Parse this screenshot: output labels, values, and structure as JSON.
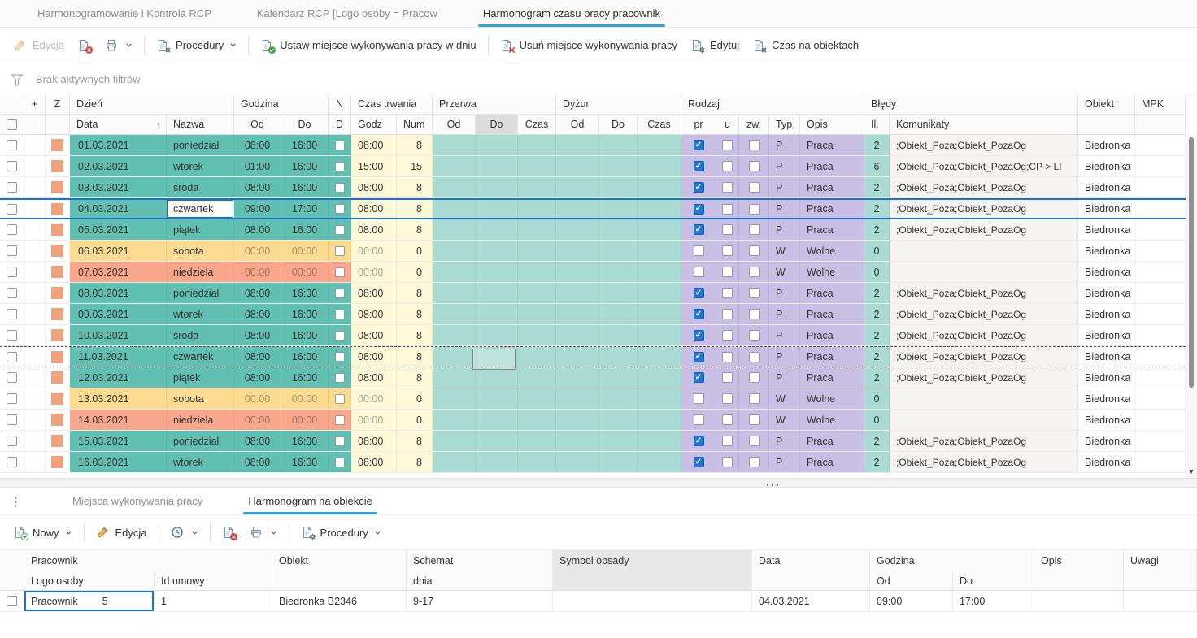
{
  "colors": {
    "accent": "#1a73c2",
    "teal": "#62c0b2",
    "teal_light": "#a9dbd2",
    "yellow_light": "#fdf8d7",
    "purple": "#c9bfe5",
    "saturday": "#fbdb90",
    "sunday": "#f9a78c",
    "z_badge": "#f1a17c",
    "check_blue": "#2176d2"
  },
  "icons": {
    "sort_asc": "↑",
    "more_vertical": "⋮",
    "scroll_down": "▼"
  },
  "tabs": {
    "items": [
      {
        "label": "Harmonogramowanie i Kontrola RCP",
        "active": false
      },
      {
        "label": "Kalendarz RCP [Logo osoby = Pracow",
        "active": false
      },
      {
        "label": "Harmonogram czasu pracy pracownik",
        "active": true
      }
    ]
  },
  "toolbar": {
    "edit_label": "Edycja",
    "procedures_label": "Procedury",
    "set_place_label": "Ustaw miejsce wykonywania pracy w dniu",
    "remove_place_label": "Usuń miejsce wykonywania pracy",
    "edit2_label": "Edytuj",
    "time_on_objects_label": "Czas na obiektach"
  },
  "filter_bar": {
    "text": "Brak aktywnych filtrów"
  },
  "splitter": {
    "grip": "..."
  },
  "grid": {
    "group_headers": {
      "plus": "+",
      "z": "Z",
      "day": "Dzień",
      "hour": "Godzina",
      "n": "N",
      "duration": "Czas trwania",
      "break": "Przerwa",
      "duty": "Dyżur",
      "type": "Rodzaj",
      "errors": "Błędy",
      "object": "Obiekt",
      "mpk": "MPK"
    },
    "sub_headers": {
      "data": "Data",
      "nazwa": "Nazwa",
      "od1": "Od",
      "do1": "Do",
      "d": "D",
      "godz": "Godz",
      "num": "Num",
      "od2": "Od",
      "do2": "Do",
      "czas2": "Czas",
      "od3": "Od",
      "do3": "Do",
      "czas3": "Czas",
      "pr": "pr",
      "u": "u",
      "zw": "zw.",
      "typ": "Typ",
      "opis": "Opis",
      "il": "Il.",
      "komunikaty": "Komunikaty"
    },
    "rows": [
      {
        "data": "01.03.2021",
        "nazwa": "poniedział",
        "od": "08:00",
        "do": "16:00",
        "godz": "08:00",
        "num": "8",
        "pr": true,
        "typ": "P",
        "opis": "Praca",
        "il": "2",
        "komunikaty": ";Obiekt_Poza;Obiekt_PozaOg",
        "obiekt": "Biedronka",
        "kind": "work"
      },
      {
        "data": "02.03.2021",
        "nazwa": "wtorek",
        "od": "01:00",
        "do": "16:00",
        "godz": "15:00",
        "num": "15",
        "pr": true,
        "typ": "P",
        "opis": "Praca",
        "il": "6",
        "komunikaty": ";Obiekt_Poza;Obiekt_PozaOg;CP > LI",
        "obiekt": "Biedronka",
        "kind": "work"
      },
      {
        "data": "03.03.2021",
        "nazwa": "środa",
        "od": "08:00",
        "do": "16:00",
        "godz": "08:00",
        "num": "8",
        "pr": true,
        "typ": "P",
        "opis": "Praca",
        "il": "2",
        "komunikaty": ";Obiekt_Poza;Obiekt_PozaOg",
        "obiekt": "Biedronka",
        "kind": "work"
      },
      {
        "data": "04.03.2021",
        "nazwa": "czwartek",
        "od": "09:00",
        "do": "17:00",
        "godz": "08:00",
        "num": "8",
        "pr": true,
        "typ": "P",
        "opis": "Praca",
        "il": "2",
        "komunikaty": ";Obiekt_Poza;Obiekt_PozaOg",
        "obiekt": "Biedronka",
        "kind": "work",
        "selected": true
      },
      {
        "data": "05.03.2021",
        "nazwa": "piątek",
        "od": "08:00",
        "do": "16:00",
        "godz": "08:00",
        "num": "8",
        "pr": true,
        "typ": "P",
        "opis": "Praca",
        "il": "2",
        "komunikaty": ";Obiekt_Poza;Obiekt_PozaOg",
        "obiekt": "Biedronka",
        "kind": "work"
      },
      {
        "data": "06.03.2021",
        "nazwa": "sobota",
        "od": "00:00",
        "do": "00:00",
        "godz": "00:00",
        "num": "0",
        "pr": false,
        "typ": "W",
        "opis": "Wolne",
        "il": "0",
        "komunikaty": "",
        "obiekt": "Biedronka",
        "kind": "sat"
      },
      {
        "data": "07.03.2021",
        "nazwa": "niedziela",
        "od": "00:00",
        "do": "00:00",
        "godz": "00:00",
        "num": "0",
        "pr": false,
        "typ": "W",
        "opis": "Wolne",
        "il": "0",
        "komunikaty": "",
        "obiekt": "Biedronka",
        "kind": "sun"
      },
      {
        "data": "08.03.2021",
        "nazwa": "poniedział",
        "od": "08:00",
        "do": "16:00",
        "godz": "08:00",
        "num": "8",
        "pr": true,
        "typ": "P",
        "opis": "Praca",
        "il": "2",
        "komunikaty": ";Obiekt_Poza;Obiekt_PozaOg",
        "obiekt": "Biedronka",
        "kind": "work"
      },
      {
        "data": "09.03.2021",
        "nazwa": "wtorek",
        "od": "08:00",
        "do": "16:00",
        "godz": "08:00",
        "num": "8",
        "pr": true,
        "typ": "P",
        "opis": "Praca",
        "il": "2",
        "komunikaty": ";Obiekt_Poza;Obiekt_PozaOg",
        "obiekt": "Biedronka",
        "kind": "work"
      },
      {
        "data": "10.03.2021",
        "nazwa": "środa",
        "od": "08:00",
        "do": "16:00",
        "godz": "08:00",
        "num": "8",
        "pr": true,
        "typ": "P",
        "opis": "Praca",
        "il": "2",
        "komunikaty": ";Obiekt_Poza;Obiekt_PozaOg",
        "obiekt": "Biedronka",
        "kind": "work"
      },
      {
        "data": "11.03.2021",
        "nazwa": "czwartek",
        "od": "08:00",
        "do": "16:00",
        "godz": "08:00",
        "num": "8",
        "pr": true,
        "typ": "P",
        "opis": "Praca",
        "il": "2",
        "komunikaty": ";Obiekt_Poza;Obiekt_PozaOg",
        "obiekt": "Biedronka",
        "kind": "work",
        "dashed": true
      },
      {
        "data": "12.03.2021",
        "nazwa": "piątek",
        "od": "08:00",
        "do": "16:00",
        "godz": "08:00",
        "num": "8",
        "pr": true,
        "typ": "P",
        "opis": "Praca",
        "il": "2",
        "komunikaty": ";Obiekt_Poza;Obiekt_PozaOg",
        "obiekt": "Biedronka",
        "kind": "work"
      },
      {
        "data": "13.03.2021",
        "nazwa": "sobota",
        "od": "00:00",
        "do": "00:00",
        "godz": "00:00",
        "num": "0",
        "pr": false,
        "typ": "W",
        "opis": "Wolne",
        "il": "0",
        "komunikaty": "",
        "obiekt": "Biedronka",
        "kind": "sat"
      },
      {
        "data": "14.03.2021",
        "nazwa": "niedziela",
        "od": "00:00",
        "do": "00:00",
        "godz": "00:00",
        "num": "0",
        "pr": false,
        "typ": "W",
        "opis": "Wolne",
        "il": "0",
        "komunikaty": "",
        "obiekt": "Biedronka",
        "kind": "sun"
      },
      {
        "data": "15.03.2021",
        "nazwa": "poniedział",
        "od": "08:00",
        "do": "16:00",
        "godz": "08:00",
        "num": "8",
        "pr": true,
        "typ": "P",
        "opis": "Praca",
        "il": "2",
        "komunikaty": ";Obiekt_Poza;Obiekt_PozaOg",
        "obiekt": "Biedronka",
        "kind": "work"
      },
      {
        "data": "16.03.2021",
        "nazwa": "wtorek",
        "od": "08:00",
        "do": "16:00",
        "godz": "08:00",
        "num": "8",
        "pr": true,
        "typ": "P",
        "opis": "Praca",
        "il": "2",
        "komunikaty": ";Obiekt_Poza;Obiekt_PozaOg",
        "obiekt": "Biedronka",
        "kind": "work"
      }
    ]
  },
  "bottom": {
    "tabs": [
      {
        "label": "Miejsca wykonywania pracy",
        "active": false
      },
      {
        "label": "Harmonogram na obiekcie",
        "active": true
      }
    ],
    "toolbar": {
      "new_label": "Nowy",
      "edit_label": "Edycja",
      "procedures_label": "Procedury"
    },
    "grid": {
      "group_headers": {
        "pracownik": "Pracownik",
        "obiekt": "Obiekt",
        "schemat": "Schemat",
        "symbol": "Symbol obsady",
        "data": "Data",
        "godzina": "Godzina",
        "opis": "Opis",
        "uwagi": "Uwagi"
      },
      "sub_headers": {
        "logo": "Logo osoby",
        "id": "Id umowy",
        "dnia": "dnia",
        "od": "Od",
        "do": "Do"
      },
      "row": {
        "logo": "Pracownik",
        "logo_value": "5",
        "id_umowy": "1",
        "obiekt": "Biedronka B2346",
        "schemat": "9-17",
        "symbol": "",
        "data": "04.03.2021",
        "od": "09:00",
        "do": "17:00",
        "opis": "",
        "uwagi": ""
      }
    }
  }
}
